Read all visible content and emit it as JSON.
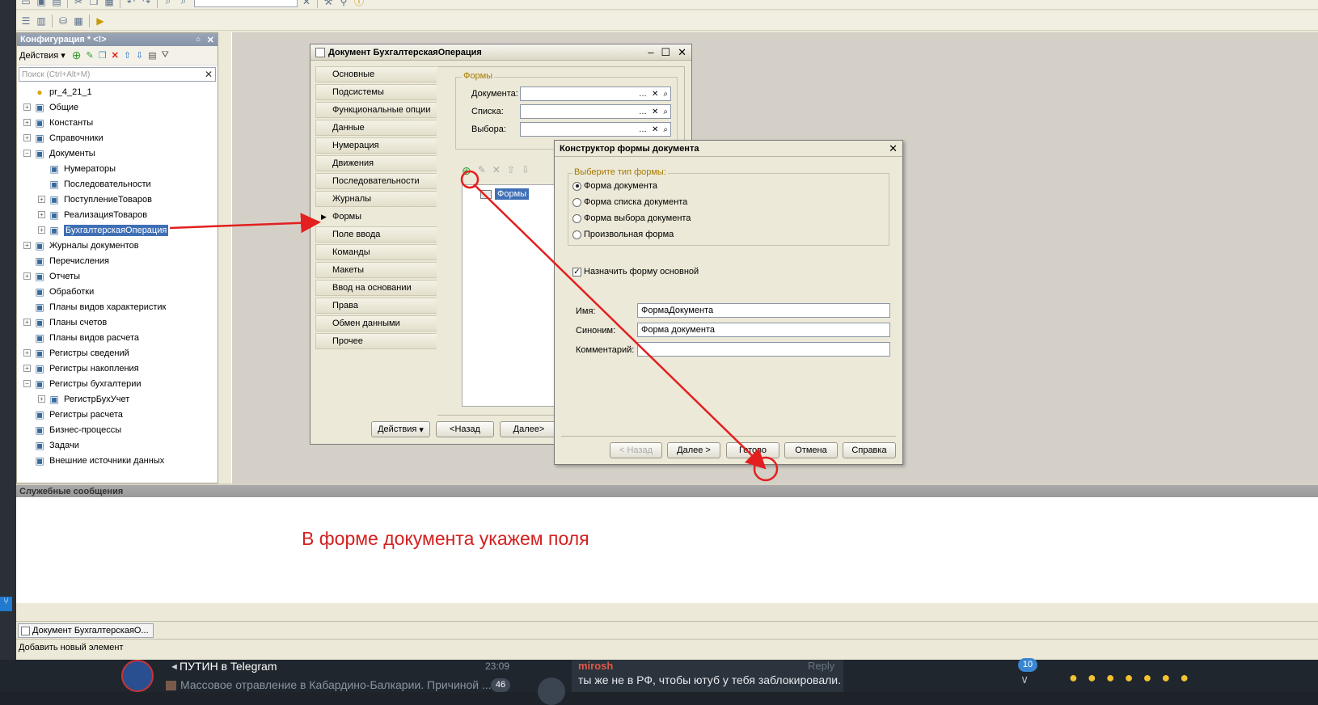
{
  "toolbar": {
    "search_value": ""
  },
  "config_panel": {
    "title": "Конфигурация * <!>",
    "pin": "⌂",
    "actions_label": "Действия",
    "search_placeholder": "Поиск (Ctrl+Alt+M)",
    "tree": [
      {
        "label": "pr_4_21_1",
        "icon": "root-icon",
        "level": 0,
        "exp": ""
      },
      {
        "label": "Общие",
        "icon": "common-icon",
        "level": 0,
        "exp": "+"
      },
      {
        "label": "Константы",
        "icon": "constants-icon",
        "level": 0,
        "exp": "+"
      },
      {
        "label": "Справочники",
        "icon": "catalogs-icon",
        "level": 0,
        "exp": "+"
      },
      {
        "label": "Документы",
        "icon": "documents-icon",
        "level": 0,
        "exp": "−"
      },
      {
        "label": "Нумераторы",
        "icon": "numerators-icon",
        "level": 1,
        "exp": ""
      },
      {
        "label": "Последовательности",
        "icon": "sequences-icon",
        "level": 1,
        "exp": ""
      },
      {
        "label": "ПоступлениеТоваров",
        "icon": "document-icon",
        "level": 1,
        "exp": "+"
      },
      {
        "label": "РеализацияТоваров",
        "icon": "document-icon",
        "level": 1,
        "exp": "+"
      },
      {
        "label": "БухгалтерскаяОперация",
        "icon": "document-icon",
        "level": 1,
        "exp": "+",
        "selected": true
      },
      {
        "label": "Журналы документов",
        "icon": "journals-icon",
        "level": 0,
        "exp": "+"
      },
      {
        "label": "Перечисления",
        "icon": "enums-icon",
        "level": 0,
        "exp": ""
      },
      {
        "label": "Отчеты",
        "icon": "reports-icon",
        "level": 0,
        "exp": "+"
      },
      {
        "label": "Обработки",
        "icon": "dataprocessors-icon",
        "level": 0,
        "exp": ""
      },
      {
        "label": "Планы видов характеристик",
        "icon": "chart-characteristics-icon",
        "level": 0,
        "exp": ""
      },
      {
        "label": "Планы счетов",
        "icon": "chart-accounts-icon",
        "level": 0,
        "exp": "+"
      },
      {
        "label": "Планы видов расчета",
        "icon": "chart-calc-icon",
        "level": 0,
        "exp": ""
      },
      {
        "label": "Регистры сведений",
        "icon": "info-registers-icon",
        "level": 0,
        "exp": "+"
      },
      {
        "label": "Регистры накопления",
        "icon": "accum-registers-icon",
        "level": 0,
        "exp": "+"
      },
      {
        "label": "Регистры бухгалтерии",
        "icon": "acc-registers-icon",
        "level": 0,
        "exp": "−"
      },
      {
        "label": "РегистрБухУчет",
        "icon": "acc-register-icon",
        "level": 1,
        "exp": "+"
      },
      {
        "label": "Регистры расчета",
        "icon": "calc-registers-icon",
        "level": 0,
        "exp": ""
      },
      {
        "label": "Бизнес-процессы",
        "icon": "bizproc-icon",
        "level": 0,
        "exp": ""
      },
      {
        "label": "Задачи",
        "icon": "tasks-icon",
        "level": 0,
        "exp": ""
      },
      {
        "label": "Внешние источники данных",
        "icon": "ext-sources-icon",
        "level": 0,
        "exp": ""
      }
    ]
  },
  "doc_window": {
    "title": "Документ БухгалтерскаяОперация",
    "tabs": [
      "Основные",
      "Подсистемы",
      "Функциональные опции",
      "Данные",
      "Нумерация",
      "Движения",
      "Последовательности",
      "Журналы",
      "Формы",
      "Поле ввода",
      "Команды",
      "Макеты",
      "Ввод на основании",
      "Права",
      "Обмен данными",
      "Прочее"
    ],
    "active_tab": "Формы",
    "group_label": "Формы",
    "fields": [
      {
        "label": "Документа:",
        "value": ""
      },
      {
        "label": "Списка:",
        "value": ""
      },
      {
        "label": "Выбора:",
        "value": ""
      }
    ],
    "forms_tree_item": "Формы",
    "buttons": {
      "actions": "Действия",
      "back": "<Назад",
      "next": "Далее>"
    }
  },
  "constructor": {
    "title": "Конструктор формы документа",
    "type_legend": "Выберите тип формы:",
    "types": [
      {
        "label": "Форма документа",
        "checked": true
      },
      {
        "label": "Форма списка документа",
        "checked": false
      },
      {
        "label": "Форма выбора документа",
        "checked": false
      },
      {
        "label": "Произвольная форма",
        "checked": false
      }
    ],
    "default_checkbox": "Назначить форму основной",
    "name_label": "Имя:",
    "name_value": "ФормаДокумента",
    "synonym_label": "Синоним:",
    "synonym_value": "Форма документа",
    "comment_label": "Комментарий:",
    "comment_value": "",
    "buttons": {
      "back": "< Назад",
      "next": "Далее >",
      "done": "Готово",
      "cancel": "Отмена",
      "help": "Справка"
    }
  },
  "messages": {
    "title": "Служебные сообщения",
    "annotation": "В форме документа укажем поля"
  },
  "taskbar": {
    "window_button": "Документ БухгалтерскаяО..."
  },
  "status_bar": "Добавить новый элемент",
  "telegram": {
    "channel": "ПУТИН в Telegram",
    "time": "23:09",
    "preview": "Массовое отравление в Кабардино-Балкарии. Причиной ...",
    "badge": "46",
    "reply_author": "mirosh",
    "reply_label": "Reply",
    "reply_text": "ты же не в РФ, чтобы ютуб у тебя заблокировали.",
    "scroll_badge": "10"
  },
  "colors": {
    "accent": "#3f6fb5",
    "arrow": "#e31f1f",
    "annotation": "#d42020"
  }
}
